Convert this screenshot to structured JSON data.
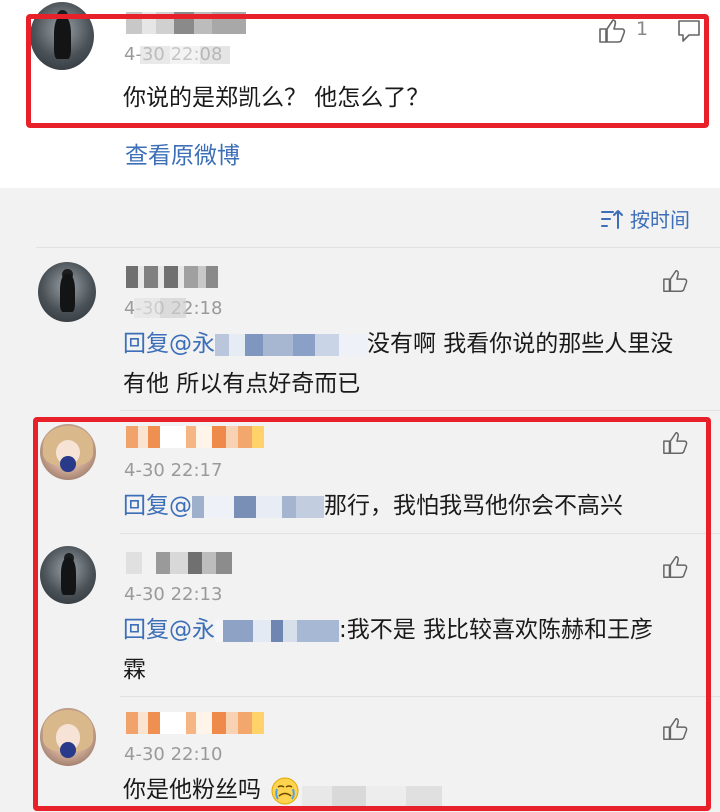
{
  "original": {
    "timestamp": "4-30 22:08",
    "like_count": "1",
    "text": "你说的是郑凯么？  他怎么了？",
    "view_original_label": "查看原微博"
  },
  "sort_label": "按时间",
  "comments": [
    {
      "timestamp": "4-30 22:18",
      "reply_prefix": "回复@永",
      "line1_tail": "没有啊  我看你说的那些人里没",
      "line2": "有他  所以有点好奇而已"
    },
    {
      "timestamp": "4-30 22:17",
      "reply_prefix": "回复@",
      "line1_tail": "那行，我怕我骂他你会不高兴"
    },
    {
      "timestamp": "4-30 22:13",
      "reply_prefix": "回复@永",
      "line1_tail": ":我不是  我比较喜欢陈赫和王彦",
      "line2": "霖"
    },
    {
      "timestamp": "4-30 22:10",
      "text": "你是他粉丝吗"
    }
  ],
  "icons": {
    "like": "thumbs-up-icon",
    "comment": "comment-icon",
    "sort": "sort-icon",
    "emoji": "crying-emoji-icon"
  },
  "colors": {
    "highlight_border": "#e8202a",
    "link": "#3c6fb8",
    "meta": "#9a9a9a"
  }
}
